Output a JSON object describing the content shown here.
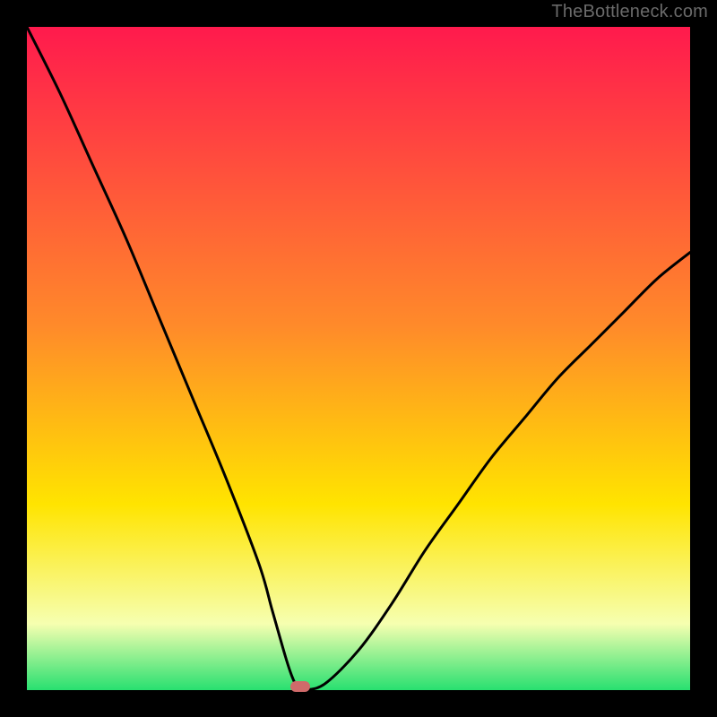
{
  "attribution": "TheBottleneck.com",
  "colors": {
    "page_bg": "#000000",
    "attribution_text": "#6a6a6a",
    "gradient_top": "#ff1a4d",
    "gradient_mid1": "#ff8a2a",
    "gradient_mid2": "#ffe400",
    "gradient_mid3": "#f6ffb0",
    "gradient_bottom": "#28e070",
    "curve": "#000000",
    "marker_fill": "#d06a6a"
  },
  "chart_data": {
    "type": "line",
    "title": "",
    "xlabel": "",
    "ylabel": "",
    "xlim": [
      0,
      100
    ],
    "ylim": [
      0,
      100
    ],
    "series": [
      {
        "name": "bottleneck-curve",
        "x": [
          0,
          5,
          10,
          15,
          20,
          25,
          30,
          35,
          37,
          39,
          40,
          41,
          42,
          45,
          50,
          55,
          60,
          65,
          70,
          75,
          80,
          85,
          90,
          95,
          100
        ],
        "values": [
          100,
          90,
          79,
          68,
          56,
          44,
          32,
          19,
          12,
          5,
          2,
          0,
          0,
          1,
          6,
          13,
          21,
          28,
          35,
          41,
          47,
          52,
          57,
          62,
          66
        ]
      }
    ],
    "marker": {
      "x": 41.2,
      "y": 0.6
    },
    "background_gradient": [
      {
        "offset": 0.0,
        "color": "#ff1a4d"
      },
      {
        "offset": 0.45,
        "color": "#ff8a2a"
      },
      {
        "offset": 0.72,
        "color": "#ffe400"
      },
      {
        "offset": 0.9,
        "color": "#f6ffb0"
      },
      {
        "offset": 1.0,
        "color": "#28e070"
      }
    ]
  }
}
